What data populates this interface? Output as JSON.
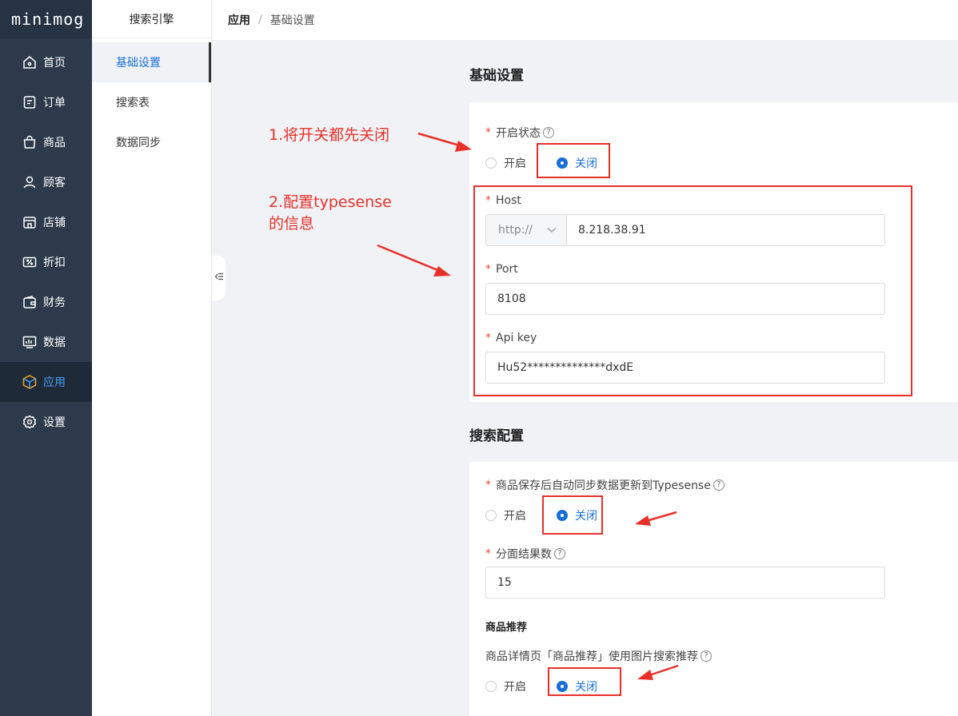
{
  "brand": {
    "logo": "minimog"
  },
  "nav": {
    "items": [
      {
        "icon": "home-icon",
        "label": "首页"
      },
      {
        "icon": "orders-icon",
        "label": "订单"
      },
      {
        "icon": "shopping-bag-icon",
        "label": "商品"
      },
      {
        "icon": "user-icon",
        "label": "顾客"
      },
      {
        "icon": "store-icon",
        "label": "店铺"
      },
      {
        "icon": "discount-icon",
        "label": "折扣"
      },
      {
        "icon": "wallet-icon",
        "label": "财务"
      },
      {
        "icon": "chart-icon",
        "label": "数据"
      },
      {
        "icon": "app-cube-icon",
        "label": "应用",
        "active": true
      },
      {
        "icon": "gear-icon",
        "label": "设置"
      }
    ]
  },
  "subnav": {
    "title": "搜索引擎",
    "items": [
      {
        "label": "基础设置",
        "active": true
      },
      {
        "label": "搜索表"
      },
      {
        "label": "数据同步"
      }
    ]
  },
  "breadcrumb": {
    "parent": "应用",
    "separator": "/",
    "current": "基础设置"
  },
  "basic": {
    "title": "基础设置",
    "status": {
      "label": "开启状态",
      "options": [
        "开启",
        "关闭"
      ],
      "selected": "关闭"
    },
    "host": {
      "label": "Host",
      "protocol": "http://",
      "value": "8.218.38.91"
    },
    "port": {
      "label": "Port",
      "value": "8108"
    },
    "api_key": {
      "label": "Api key",
      "value": "Hu52**************dxdE"
    }
  },
  "search": {
    "title": "搜索配置",
    "auto_sync": {
      "label": "商品保存后自动同步数据更新到Typesense",
      "options": [
        "开启",
        "关闭"
      ],
      "selected": "关闭"
    },
    "facet_count": {
      "label": "分面结果数",
      "value": "15"
    },
    "recommend": {
      "heading": "商品推荐",
      "label": "商品详情页「商品推荐」使用图片搜索推荐",
      "options": [
        "开启",
        "关闭"
      ],
      "selected": "关闭"
    }
  },
  "annotations": {
    "note1": "1.将开关都先关闭",
    "note2_line1": "2.配置typesense",
    "note2_line2": "的信息",
    "color": "#e8302a"
  },
  "colors": {
    "sidebar_bg": "#2d3a4b",
    "accent": "#1a6fd6",
    "required": "#e74c3c"
  },
  "help_glyph": "?",
  "required_mark": "*"
}
